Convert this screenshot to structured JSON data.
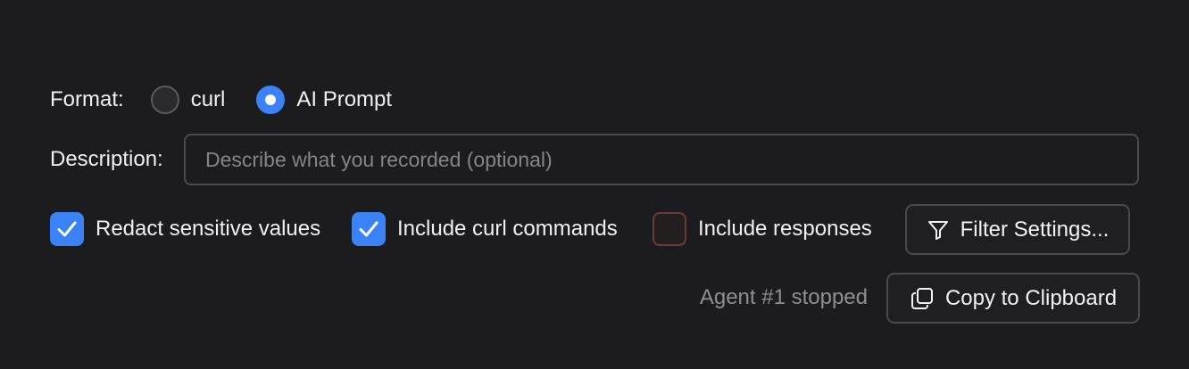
{
  "format": {
    "label": "Format:",
    "options": [
      {
        "label": "curl",
        "selected": false
      },
      {
        "label": "AI Prompt",
        "selected": true
      }
    ]
  },
  "description": {
    "label": "Description:",
    "placeholder": "Describe what you recorded (optional)",
    "value": ""
  },
  "options": {
    "redact": {
      "label": "Redact sensitive values",
      "checked": true
    },
    "include_curl": {
      "label": "Include curl commands",
      "checked": true
    },
    "include_responses": {
      "label": "Include responses",
      "checked": false
    }
  },
  "buttons": {
    "filter_settings": "Filter Settings...",
    "copy_clipboard": "Copy to Clipboard"
  },
  "status": "Agent #1 stopped",
  "colors": {
    "accent": "#3b82f6",
    "background": "#1c1c1e"
  }
}
